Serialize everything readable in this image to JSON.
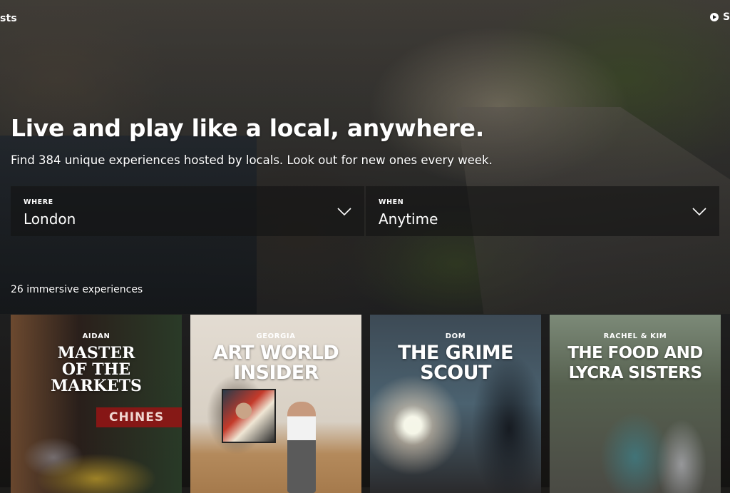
{
  "header": {
    "left_partial": "sts",
    "right_partial": "S"
  },
  "hero": {
    "headline": "Live and play like a local, anywhere.",
    "subline": "Find 384 unique experiences hosted by locals. Look out for new ones every week."
  },
  "search": {
    "where_label": "WHERE",
    "where_value": "London",
    "when_label": "WHEN",
    "when_value": "Anytime"
  },
  "results": {
    "count_text": "26 immersive experiences"
  },
  "cards": [
    {
      "host": "AIDAN",
      "title_lines": [
        "MASTER",
        "OF THE",
        "MARKETS"
      ],
      "photo_text": "CHINES"
    },
    {
      "host": "GEORGIA",
      "title_lines": [
        "ART WORLD",
        "INSIDER"
      ]
    },
    {
      "host": "DOM",
      "title_lines": [
        "THE GRIME",
        "SCOUT"
      ]
    },
    {
      "host": "RACHEL & KIM",
      "title_lines": [
        "THE FOOD AND",
        "LYCRA SISTERS"
      ]
    }
  ],
  "icons": {
    "play": "play-icon",
    "chevron": "chevron-down-icon"
  }
}
